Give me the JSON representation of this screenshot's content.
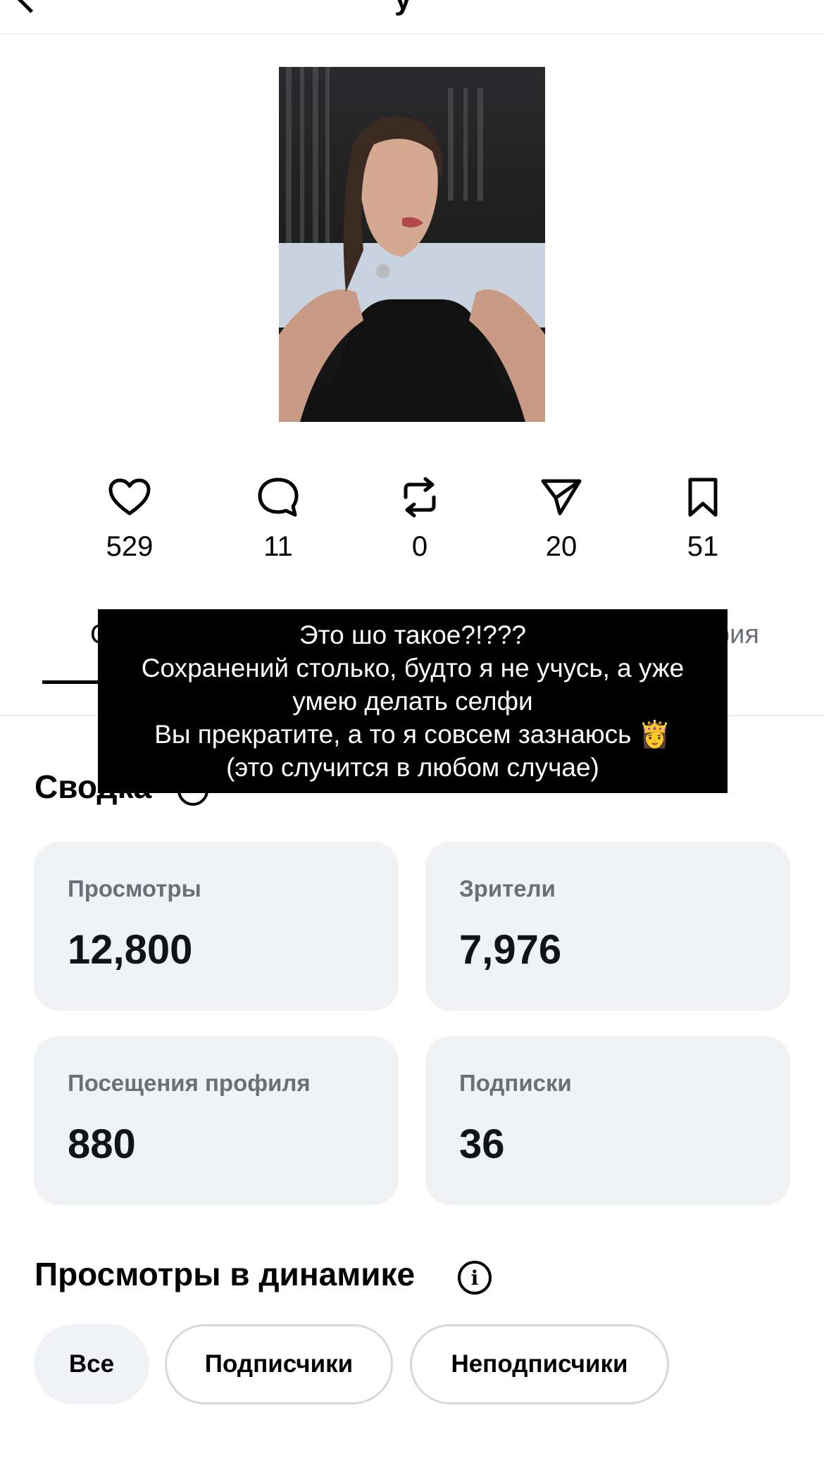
{
  "header": {
    "title_fragment": "у",
    "back_icon": "chevron-left-icon"
  },
  "post": {
    "image_description_icon": "selfie-photo"
  },
  "engagement": {
    "likes": "529",
    "comments": "11",
    "reposts": "0",
    "shares": "20",
    "bookmarks": "51"
  },
  "tabs": {
    "left_fragment": "С",
    "right_fragment": "рия"
  },
  "caption": {
    "lines": [
      "Это шо такое?!???",
      "Сохранений столько, будто я не учусь, а уже",
      "умею делать селфи",
      "Вы прекратите, а то я совсем зазнаюсь 👸",
      "(это случится в любом случае)"
    ]
  },
  "summary": {
    "title": "Сводка",
    "cards": [
      {
        "label": "Просмотры",
        "value": "12,800"
      },
      {
        "label": "Зрители",
        "value": "7,976"
      },
      {
        "label": "Посещения профиля",
        "value": "880"
      },
      {
        "label": "Подписки",
        "value": "36"
      }
    ]
  },
  "dynamics": {
    "title": "Просмотры в динамике",
    "info_glyph": "i",
    "filters": [
      "Все",
      "Подписчики",
      "Неподписчики"
    ],
    "selected_filter": "Все"
  }
}
